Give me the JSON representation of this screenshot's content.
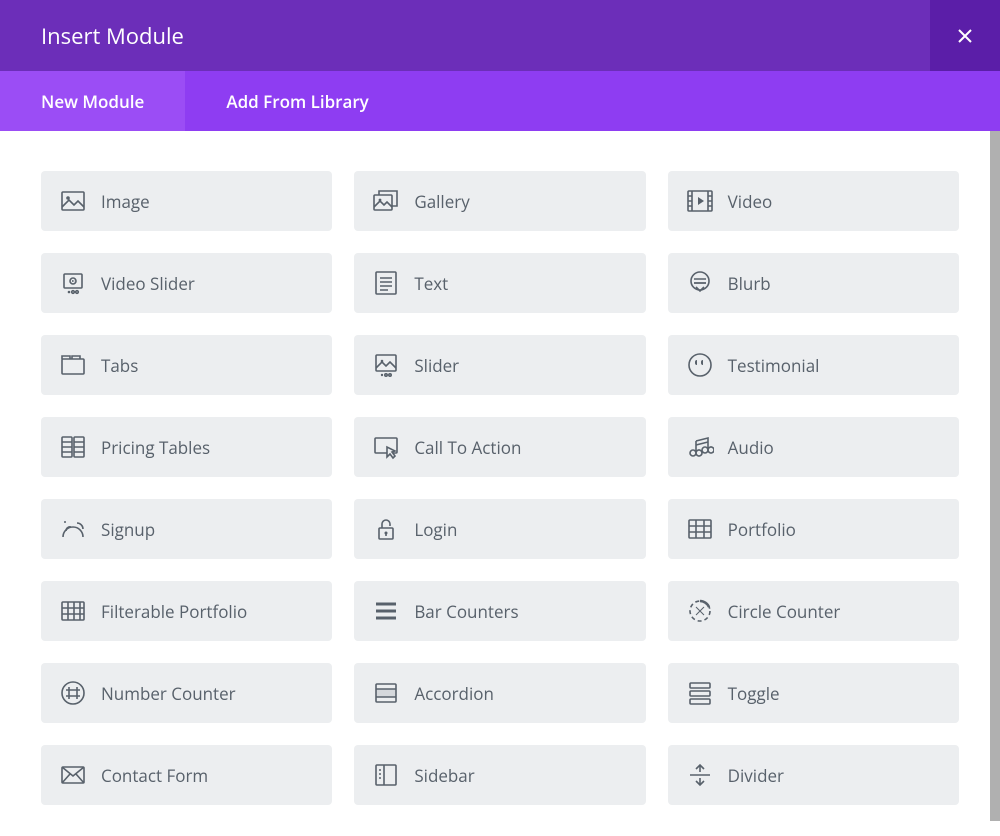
{
  "header": {
    "title": "Insert Module"
  },
  "tabs": [
    {
      "label": "New Module",
      "active": true
    },
    {
      "label": "Add From Library",
      "active": false
    }
  ],
  "modules": [
    {
      "icon": "image-icon",
      "label": "Image"
    },
    {
      "icon": "gallery-icon",
      "label": "Gallery"
    },
    {
      "icon": "video-icon",
      "label": "Video"
    },
    {
      "icon": "video-slider-icon",
      "label": "Video Slider"
    },
    {
      "icon": "text-icon",
      "label": "Text"
    },
    {
      "icon": "blurb-icon",
      "label": "Blurb"
    },
    {
      "icon": "tabs-icon",
      "label": "Tabs"
    },
    {
      "icon": "slider-icon",
      "label": "Slider"
    },
    {
      "icon": "testimonial-icon",
      "label": "Testimonial"
    },
    {
      "icon": "pricing-tables-icon",
      "label": "Pricing Tables"
    },
    {
      "icon": "call-to-action-icon",
      "label": "Call To Action"
    },
    {
      "icon": "audio-icon",
      "label": "Audio"
    },
    {
      "icon": "signup-icon",
      "label": "Signup"
    },
    {
      "icon": "login-icon",
      "label": "Login"
    },
    {
      "icon": "portfolio-icon",
      "label": "Portfolio"
    },
    {
      "icon": "filterable-portfolio-icon",
      "label": "Filterable Portfolio"
    },
    {
      "icon": "bar-counters-icon",
      "label": "Bar Counters"
    },
    {
      "icon": "circle-counter-icon",
      "label": "Circle Counter"
    },
    {
      "icon": "number-counter-icon",
      "label": "Number Counter"
    },
    {
      "icon": "accordion-icon",
      "label": "Accordion"
    },
    {
      "icon": "toggle-icon",
      "label": "Toggle"
    },
    {
      "icon": "contact-form-icon",
      "label": "Contact Form"
    },
    {
      "icon": "sidebar-icon",
      "label": "Sidebar"
    },
    {
      "icon": "divider-icon",
      "label": "Divider"
    }
  ]
}
